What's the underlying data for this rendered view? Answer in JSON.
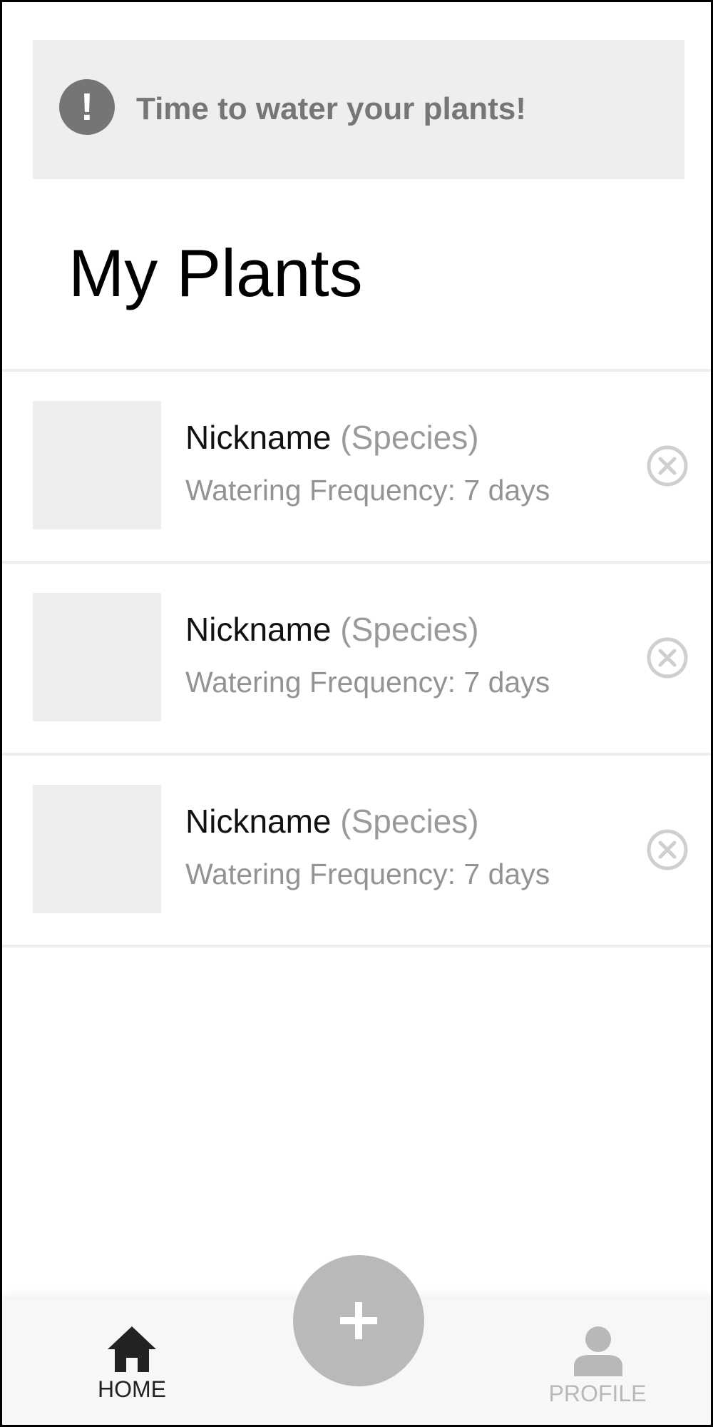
{
  "alert": {
    "icon": "exclamation-icon",
    "icon_glyph": "!",
    "message": "Time to water your plants!"
  },
  "page": {
    "title": "My Plants"
  },
  "plants": [
    {
      "nickname": "Nickname",
      "species": "(Species)",
      "frequency": "Watering Frequency: 7 days",
      "remove_icon": "close-circle-icon"
    },
    {
      "nickname": "Nickname",
      "species": "(Species)",
      "frequency": "Watering Frequency: 7 days",
      "remove_icon": "close-circle-icon"
    },
    {
      "nickname": "Nickname",
      "species": "(Species)",
      "frequency": "Watering Frequency: 7 days",
      "remove_icon": "close-circle-icon"
    }
  ],
  "bottom_nav": {
    "home_label": "HOME",
    "home_icon": "home-icon",
    "profile_label": "PROFILE",
    "profile_icon": "person-icon",
    "add_icon": "plus-icon"
  },
  "colors": {
    "alert_bg": "#eeeeee",
    "alert_icon_bg": "#757575",
    "fab_bg": "#b9b9b9",
    "active_nav": "#222222",
    "inactive_nav": "#b8b8b8"
  }
}
